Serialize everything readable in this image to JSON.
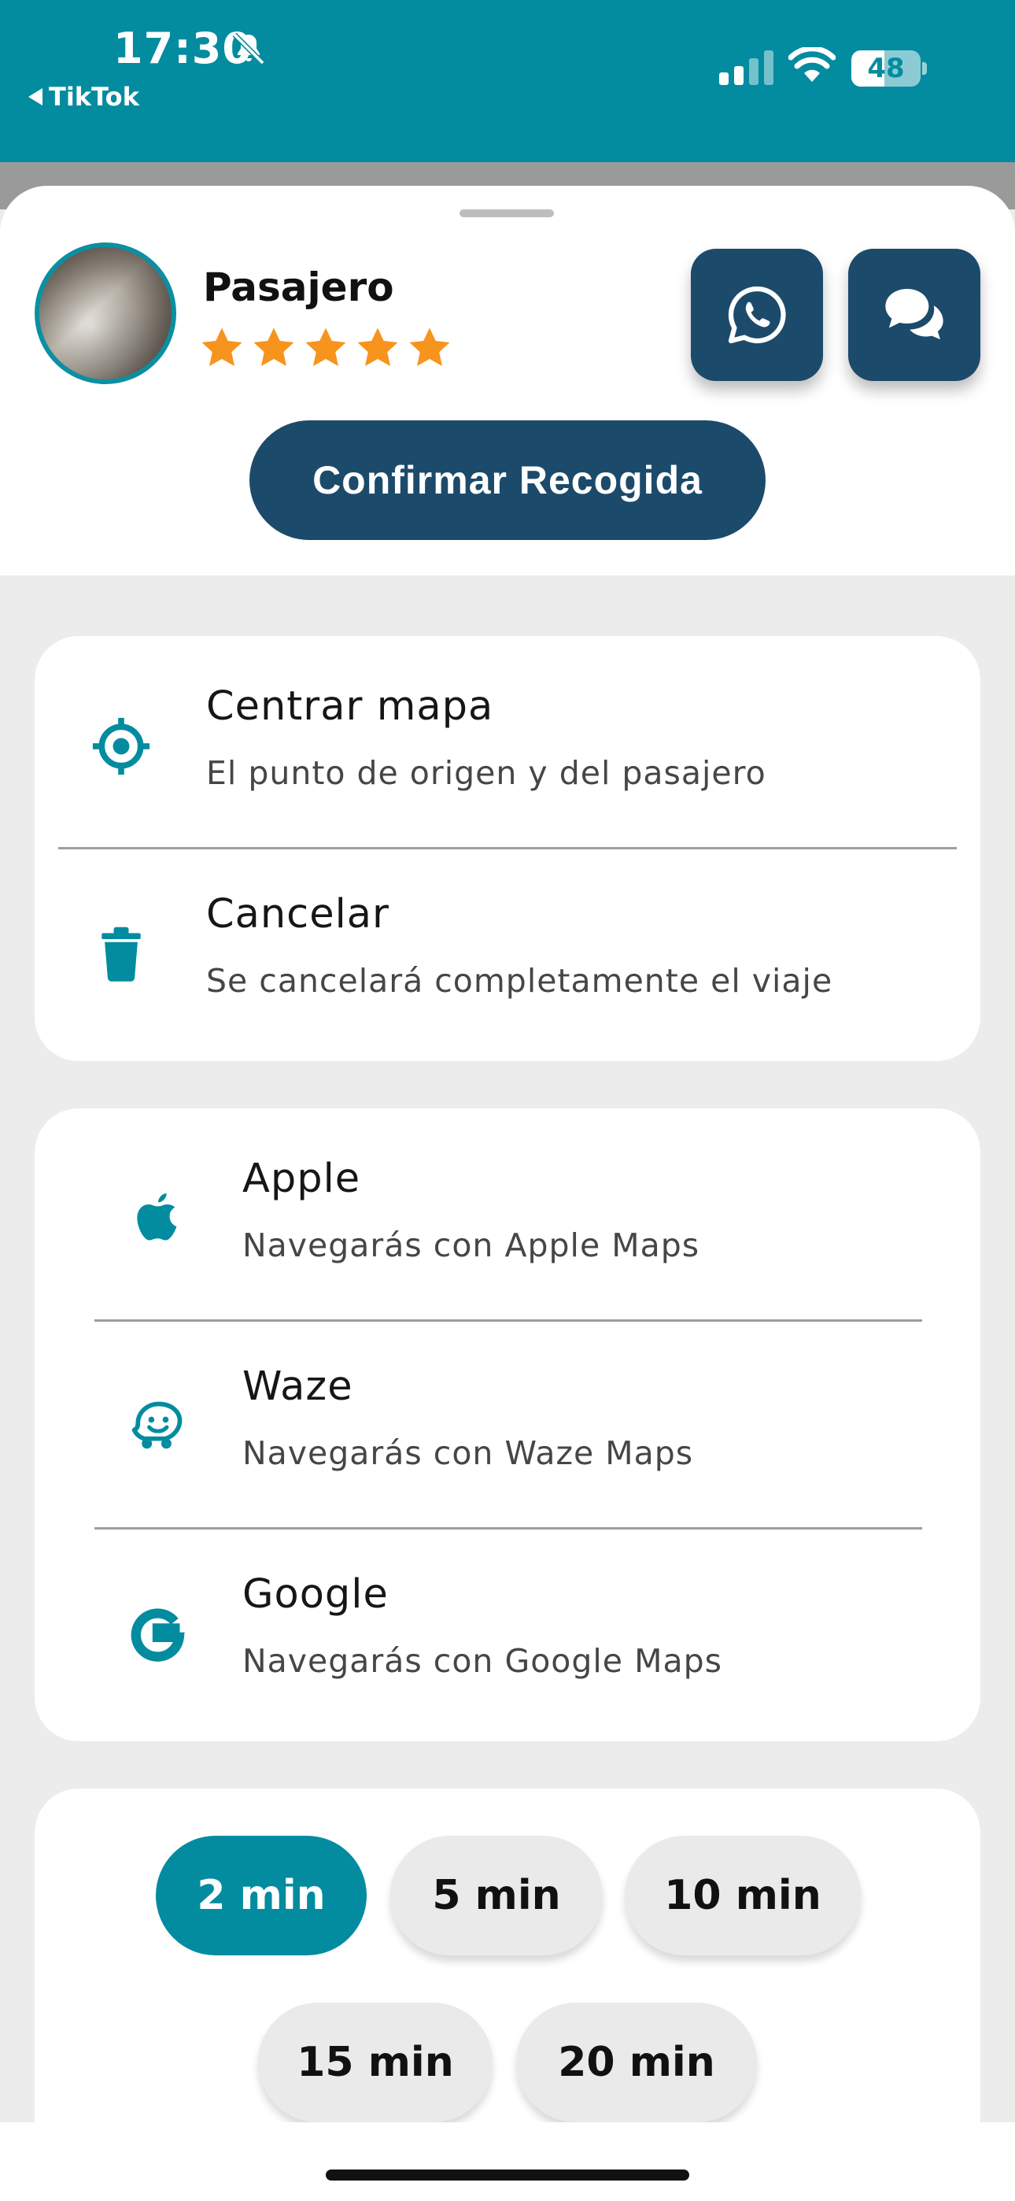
{
  "status_bar": {
    "time": "17:30",
    "back_app": "TikTok",
    "battery": "48",
    "battery_level": 0.48,
    "icons": [
      "bell-slash-icon",
      "cellular-signal-icon",
      "wifi-icon",
      "battery-icon"
    ]
  },
  "passenger": {
    "name": "Pasajero",
    "rating": 5,
    "rating_max": 5
  },
  "actions": {
    "whatsapp_icon": "whatsapp-icon",
    "chat_icon": "chat-bubbles-icon",
    "confirm_label": "Confirmar Recogida"
  },
  "trip_options": [
    {
      "icon": "crosshair-icon",
      "title": "Centrar mapa",
      "subtitle": "El punto de origen y del pasajero"
    },
    {
      "icon": "trash-icon",
      "title": "Cancelar",
      "subtitle": "Se cancelará completamente el viaje"
    }
  ],
  "navigation_apps": [
    {
      "icon": "apple-icon",
      "title": "Apple",
      "subtitle": "Navegarás con Apple Maps"
    },
    {
      "icon": "waze-icon",
      "title": "Waze",
      "subtitle": "Navegarás con Waze Maps"
    },
    {
      "icon": "google-icon",
      "title": "Google",
      "subtitle": "Navegarás con Google Maps"
    }
  ],
  "wait_times": {
    "selected": "2 min",
    "options": [
      "2 min",
      "5 min",
      "10 min",
      "15 min",
      "20 min"
    ]
  },
  "colors": {
    "teal": "#038ca0",
    "navy": "#1c4a6b",
    "star": "#f7941d",
    "background": "#ececec"
  }
}
